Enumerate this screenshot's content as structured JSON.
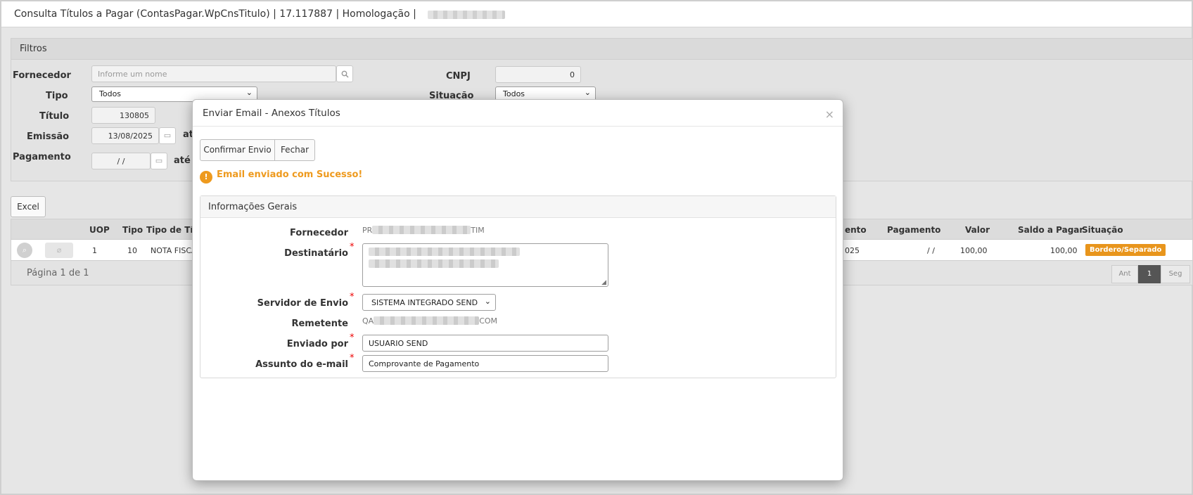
{
  "window": {
    "title": "Consulta Títulos a Pagar (ContasPagar.WpCnsTitulo) | 17.117887 | Homologação |"
  },
  "filters": {
    "panel_title": "Filtros",
    "fornecedor_label": "Fornecedor",
    "fornecedor_placeholder": "Informe um nome",
    "tipo_label": "Tipo",
    "tipo_value": "Todos",
    "titulo_label": "Título",
    "titulo_value": "130805",
    "emissao_label": "Emissão",
    "emissao_value": "13/08/2025",
    "emissao_ate": "at",
    "pagamento_label": "Pagamento",
    "pagamento_value": "/ /",
    "pagamento_ate": "até",
    "cnpj_label": "CNPJ",
    "cnpj_value": "0",
    "situacao_label": "Situação",
    "situacao_value": "Todos"
  },
  "toolbar": {
    "excel_label": "Excel"
  },
  "grid": {
    "headers": {
      "uop": "UOP",
      "tipo": "Tipo",
      "tipo_titulo": "Tipo de Títu",
      "vencimento_partial": "ento",
      "pagamento": "Pagamento",
      "valor": "Valor",
      "saldo": "Saldo a Pagar",
      "situacao": "Situação"
    },
    "row": {
      "uop": "1",
      "tipo": "10",
      "tipo_titulo": "NOTA FISCA",
      "vencimento_partial": "025",
      "pagamento": "/ /",
      "valor": "100,00",
      "saldo": "100,00",
      "situacao": "Bordero/Separado"
    },
    "page_info": "Página 1 de 1",
    "pager": {
      "prev": "Ant",
      "current": "1",
      "next": "Seg"
    }
  },
  "modal": {
    "title": "Enviar Email - Anexos Títulos",
    "close_symbol": "×",
    "confirm_label": "Confirmar Envio",
    "close_label": "Fechar",
    "success_message": "Email enviado com Sucesso!",
    "section_title": "Informações Gerais",
    "fornecedor_label": "Fornecedor",
    "fornecedor_prefix": "PR",
    "fornecedor_suffix": "TIM",
    "destinatario_label": "Destinatário",
    "servidor_label": "Servidor de Envio",
    "servidor_value": "SISTEMA INTEGRADO SEND",
    "remetente_label": "Remetente",
    "remetente_prefix": "QA",
    "remetente_suffix": "COM",
    "enviado_label": "Enviado por",
    "enviado_value": "USUARIO SEND",
    "assunto_label": "Assunto do e-mail",
    "assunto_value": "Comprovante de Pagamento",
    "required_mark": "*"
  },
  "colors": {
    "accent_orange": "#ee9a1e",
    "badge_orange": "#e8951c",
    "required_red": "#e00000"
  }
}
